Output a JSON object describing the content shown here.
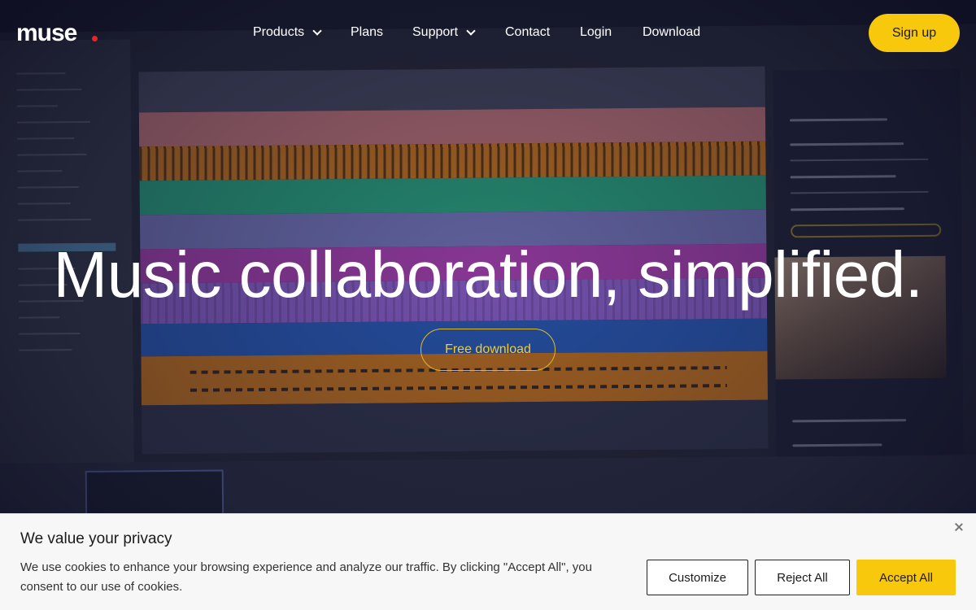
{
  "brand": {
    "logo_text": "muse",
    "dot_color": "#e8232b"
  },
  "nav": {
    "items": [
      {
        "label": "Products",
        "has_dropdown": true
      },
      {
        "label": "Plans",
        "has_dropdown": false
      },
      {
        "label": "Support",
        "has_dropdown": true
      },
      {
        "label": "Contact",
        "has_dropdown": false
      },
      {
        "label": "Login",
        "has_dropdown": false
      },
      {
        "label": "Download",
        "has_dropdown": false
      }
    ],
    "signup_label": "Sign up"
  },
  "hero": {
    "headline": "Music collaboration, simplified.",
    "cta_label": "Free download"
  },
  "cookie_banner": {
    "title": "We value your privacy",
    "text": "We use cookies to enhance your browsing experience and analyze our traffic. By clicking \"Accept All\", you consent to our use of cookies.",
    "customize_label": "Customize",
    "reject_label": "Reject All",
    "accept_label": "Accept All"
  },
  "colors": {
    "accent": "#f7c80b",
    "page_background": "#0e0f1e",
    "banner_background": "#f7f7f7"
  }
}
